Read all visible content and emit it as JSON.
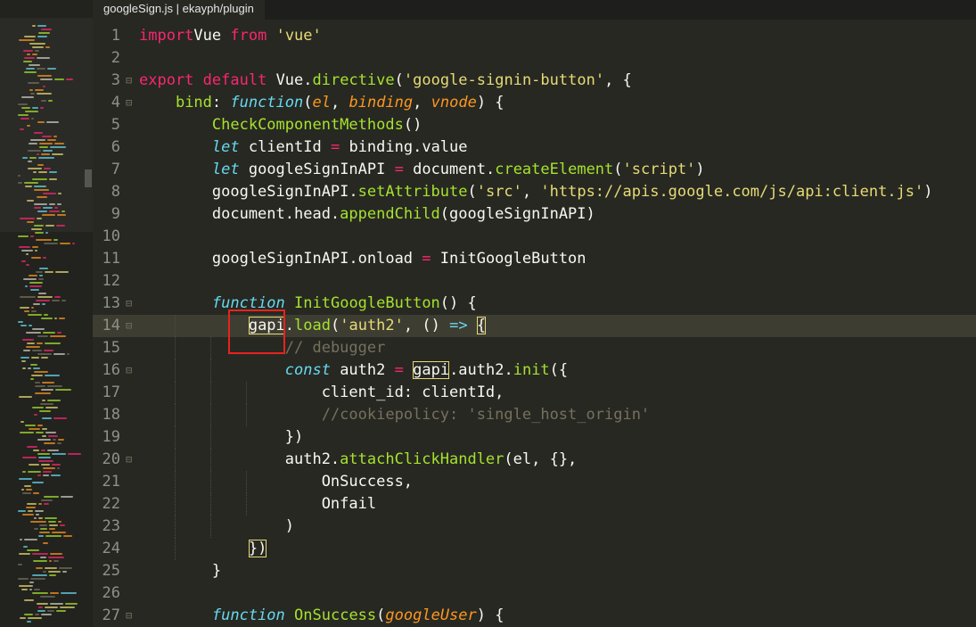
{
  "tab": {
    "title": "googleSign.js | ekayph/plugin"
  },
  "colors": {
    "background": "#272822",
    "keyword": "#f92672",
    "string": "#e6db74",
    "function": "#a6e22e",
    "storage": "#66d9ef",
    "param": "#fd971f",
    "comment": "#75715e",
    "annotation": "#e8221f"
  },
  "icons": {
    "fold": "fold-toggle-icon"
  },
  "lines": [
    {
      "n": "1",
      "fold": false,
      "tokens": [
        [
          "kw",
          "import"
        ],
        [
          "",
          "Vue "
        ],
        [
          "kw",
          "from"
        ],
        [
          "",
          " "
        ],
        [
          "st",
          "'vue'"
        ]
      ]
    },
    {
      "n": "2",
      "fold": false,
      "tokens": []
    },
    {
      "n": "3",
      "fold": true,
      "tokens": [
        [
          "kw",
          "export"
        ],
        [
          "",
          " "
        ],
        [
          "kw",
          "default"
        ],
        [
          "",
          " Vue."
        ],
        [
          "fnm",
          "directive"
        ],
        [
          "",
          "("
        ],
        [
          "st",
          "'google-signin-button'"
        ],
        [
          "",
          ", {"
        ]
      ]
    },
    {
      "n": "4",
      "fold": true,
      "tokens": [
        [
          "",
          "    "
        ],
        [
          "fnm",
          "bind"
        ],
        [
          "",
          ": "
        ],
        [
          "cy",
          "function"
        ],
        [
          "",
          "("
        ],
        [
          "pa",
          "el"
        ],
        [
          "",
          ", "
        ],
        [
          "pa",
          "binding"
        ],
        [
          "",
          ", "
        ],
        [
          "pa",
          "vnode"
        ],
        [
          "",
          ") {"
        ]
      ]
    },
    {
      "n": "5",
      "fold": false,
      "tokens": [
        [
          "",
          "        "
        ],
        [
          "fnm",
          "CheckComponentMethods"
        ],
        [
          "",
          "()"
        ]
      ]
    },
    {
      "n": "6",
      "fold": false,
      "tokens": [
        [
          "",
          "        "
        ],
        [
          "cy",
          "let"
        ],
        [
          "",
          " clientId "
        ],
        [
          "kw",
          "="
        ],
        [
          "",
          " binding.value"
        ]
      ]
    },
    {
      "n": "7",
      "fold": false,
      "tokens": [
        [
          "",
          "        "
        ],
        [
          "cy",
          "let"
        ],
        [
          "",
          " googleSignInAPI "
        ],
        [
          "kw",
          "="
        ],
        [
          "",
          " document."
        ],
        [
          "fnm",
          "createElement"
        ],
        [
          "",
          "("
        ],
        [
          "st",
          "'script'"
        ],
        [
          "",
          ")"
        ]
      ]
    },
    {
      "n": "8",
      "fold": false,
      "tokens": [
        [
          "",
          "        googleSignInAPI."
        ],
        [
          "fnm",
          "setAttribute"
        ],
        [
          "",
          "("
        ],
        [
          "st",
          "'src'"
        ],
        [
          "",
          ", "
        ],
        [
          "st",
          "'https://apis.google.com/js/api:client.js'"
        ],
        [
          "",
          ")"
        ]
      ]
    },
    {
      "n": "9",
      "fold": false,
      "tokens": [
        [
          "",
          "        document.head."
        ],
        [
          "fnm",
          "appendChild"
        ],
        [
          "",
          "(googleSignInAPI)"
        ]
      ]
    },
    {
      "n": "10",
      "fold": false,
      "tokens": []
    },
    {
      "n": "11",
      "fold": false,
      "tokens": [
        [
          "",
          "        googleSignInAPI.onload "
        ],
        [
          "kw",
          "="
        ],
        [
          "",
          " InitGoogleButton"
        ]
      ]
    },
    {
      "n": "12",
      "fold": false,
      "tokens": []
    },
    {
      "n": "13",
      "fold": true,
      "tokens": [
        [
          "",
          "        "
        ],
        [
          "cy",
          "function"
        ],
        [
          "",
          " "
        ],
        [
          "fnm",
          "InitGoogleButton"
        ],
        [
          "",
          "() {"
        ]
      ]
    },
    {
      "n": "14",
      "fold": true,
      "tokens": [
        [
          "",
          "            "
        ],
        [
          "hl",
          "gapi"
        ],
        [
          "",
          "."
        ],
        [
          "fnm",
          "load"
        ],
        [
          "",
          "("
        ],
        [
          "st",
          "'auth2'"
        ],
        [
          "",
          ", () "
        ],
        [
          "cy",
          "=>"
        ],
        [
          "",
          " "
        ],
        [
          "hl",
          "{"
        ]
      ]
    },
    {
      "n": "15",
      "fold": false,
      "tokens": [
        [
          "",
          "                "
        ],
        [
          "cm",
          "// debugger"
        ]
      ]
    },
    {
      "n": "16",
      "fold": true,
      "tokens": [
        [
          "",
          "                "
        ],
        [
          "cy",
          "const"
        ],
        [
          "",
          " auth2 "
        ],
        [
          "kw",
          "="
        ],
        [
          "",
          " "
        ],
        [
          "hl",
          "gapi"
        ],
        [
          "",
          ".auth2."
        ],
        [
          "fnm",
          "init"
        ],
        [
          "",
          "({"
        ]
      ]
    },
    {
      "n": "17",
      "fold": false,
      "tokens": [
        [
          "",
          "                    client_id: clientId,"
        ]
      ]
    },
    {
      "n": "18",
      "fold": false,
      "tokens": [
        [
          "",
          "                    "
        ],
        [
          "cm",
          "//cookiepolicy: 'single_host_origin'"
        ]
      ]
    },
    {
      "n": "19",
      "fold": false,
      "tokens": [
        [
          "",
          "                })"
        ]
      ]
    },
    {
      "n": "20",
      "fold": true,
      "tokens": [
        [
          "",
          "                auth2."
        ],
        [
          "fnm",
          "attachClickHandler"
        ],
        [
          "",
          "(el, {},"
        ]
      ]
    },
    {
      "n": "21",
      "fold": false,
      "tokens": [
        [
          "",
          "                    OnSuccess,"
        ]
      ]
    },
    {
      "n": "22",
      "fold": false,
      "tokens": [
        [
          "",
          "                    Onfail"
        ]
      ]
    },
    {
      "n": "23",
      "fold": false,
      "tokens": [
        [
          "",
          "                )"
        ]
      ]
    },
    {
      "n": "24",
      "fold": false,
      "tokens": [
        [
          "",
          "            "
        ],
        [
          "hl",
          "})"
        ]
      ]
    },
    {
      "n": "25",
      "fold": false,
      "tokens": [
        [
          "",
          "        }"
        ]
      ]
    },
    {
      "n": "26",
      "fold": false,
      "tokens": []
    },
    {
      "n": "27",
      "fold": true,
      "tokens": [
        [
          "",
          "        "
        ],
        [
          "cy",
          "function"
        ],
        [
          "",
          " "
        ],
        [
          "fnm",
          "OnSuccess"
        ],
        [
          "",
          "("
        ],
        [
          "pa",
          "googleUser"
        ],
        [
          "",
          ") {"
        ]
      ]
    }
  ]
}
